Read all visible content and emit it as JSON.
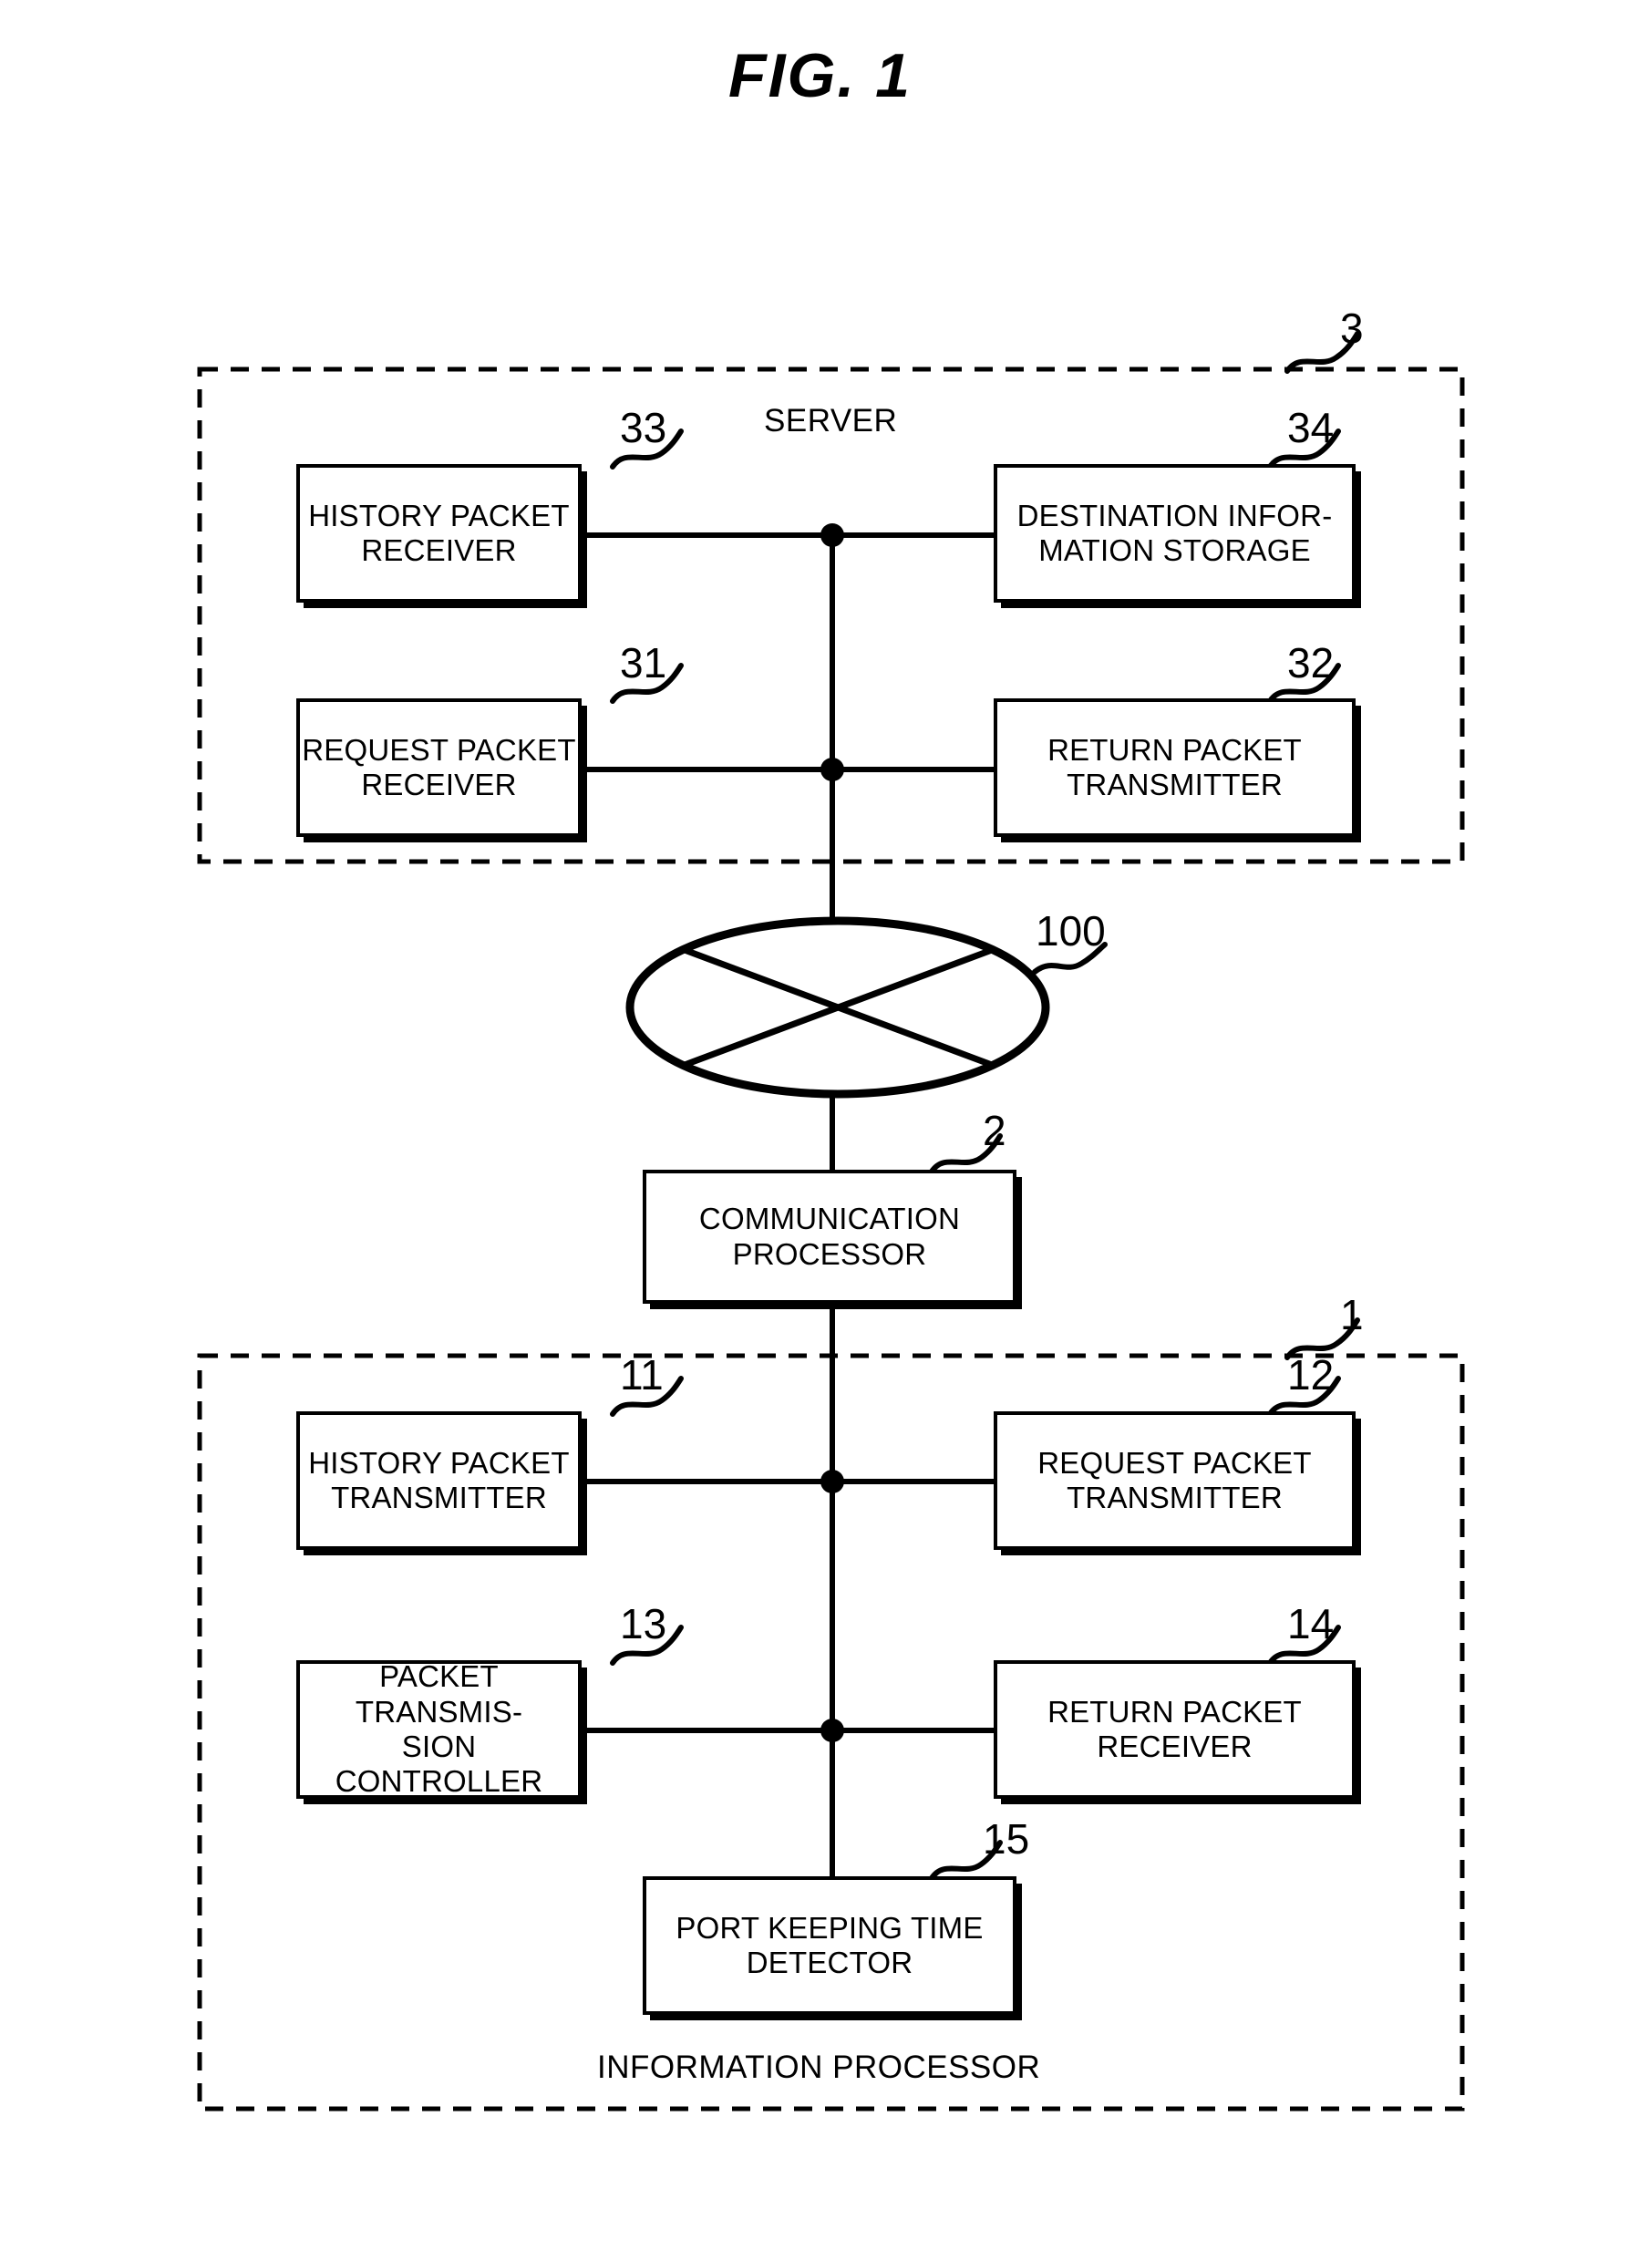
{
  "figure": {
    "title": "FIG. 1",
    "caption_server": "SERVER",
    "caption_information_processor": "INFORMATION PROCESSOR"
  },
  "refs": {
    "server_group": "3",
    "history_packet_receiver": "33",
    "destination_information_storage": "34",
    "request_packet_receiver": "31",
    "return_packet_transmitter": "32",
    "network": "100",
    "communication_processor": "2",
    "information_processor_group": "1",
    "history_packet_transmitter": "11",
    "request_packet_transmitter": "12",
    "packet_transmission_controller": "13",
    "return_packet_receiver": "14",
    "port_keeping_time_detector": "15"
  },
  "blocks": {
    "history_packet_receiver": "HISTORY PACKET\nRECEIVER",
    "destination_information_storage": "DESTINATION INFOR-\nMATION STORAGE",
    "request_packet_receiver": "REQUEST PACKET\nRECEIVER",
    "return_packet_transmitter": "RETURN PACKET\nTRANSMITTER",
    "communication_processor": "COMMUNICATION\nPROCESSOR",
    "history_packet_transmitter": "HISTORY PACKET\nTRANSMITTER",
    "request_packet_transmitter": "REQUEST PACKET\nTRANSMITTER",
    "packet_transmission_controller": "PACKET TRANSMIS-\nSION CONTROLLER",
    "return_packet_receiver": "RETURN PACKET\nRECEIVER",
    "port_keeping_time_detector": "PORT KEEPING TIME\nDETECTOR"
  },
  "icons": {
    "network_cloud": "network-ellipse-icon",
    "junction": "junction-dot-icon",
    "leader": "leader-squiggle-icon"
  },
  "colors": {
    "ink": "#000000",
    "paper": "#ffffff"
  }
}
